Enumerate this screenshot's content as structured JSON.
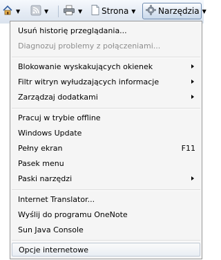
{
  "toolbar": {
    "icons": {
      "home": "home-icon",
      "feeds": "rss-feed-icon",
      "print": "printer-icon",
      "tools": "gear-icon",
      "dropdown": "chevron-down-icon"
    },
    "page_label": "Strona",
    "tools_label": "Narzędzia"
  },
  "menu": {
    "groups": [
      {
        "items": [
          {
            "label": "Usuń historię przeglądania...",
            "enabled": true
          },
          {
            "label": "Diagnozuj problemy z połączeniami...",
            "enabled": false
          }
        ]
      },
      {
        "items": [
          {
            "label": "Blokowanie wyskakujących okienek",
            "submenu": true
          },
          {
            "label": "Filtr witryn wyłudzających informacje",
            "submenu": true
          },
          {
            "label": "Zarządzaj dodatkami",
            "submenu": true
          }
        ]
      },
      {
        "items": [
          {
            "label": "Pracuj w trybie offline"
          },
          {
            "label": "Windows Update"
          },
          {
            "label": "Pełny ekran",
            "shortcut": "F11"
          },
          {
            "label": "Pasek menu"
          },
          {
            "label": "Paski narzędzi",
            "submenu": true
          }
        ]
      },
      {
        "items": [
          {
            "label": "Internet Translator..."
          },
          {
            "label": "Wyślij do programu OneNote"
          },
          {
            "label": "Sun Java Console"
          }
        ]
      },
      {
        "items": [
          {
            "label": "Opcje internetowe",
            "highlighted": true
          }
        ]
      }
    ]
  },
  "colors": {
    "toolbar_bg": "#e4ebf4",
    "menu_bg": "#f5f5f5",
    "disabled_text": "#8d8d8d",
    "highlight_border": "#c0cad6"
  }
}
